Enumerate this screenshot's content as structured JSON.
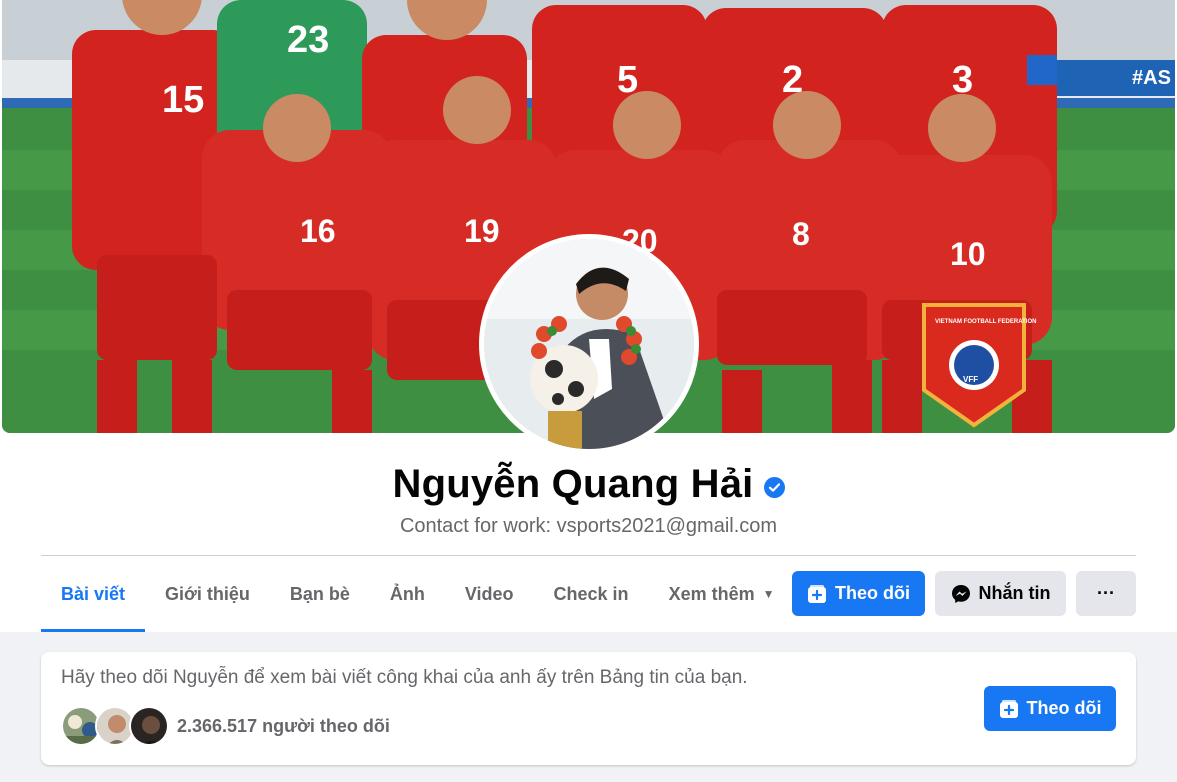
{
  "profile": {
    "name": "Nguyễn Quang Hải",
    "bio": "Contact for work: vsports2021@gmail.com",
    "verified": true
  },
  "cover": {
    "jersey_numbers": [
      "15",
      "23",
      "5",
      "2",
      "3",
      "16",
      "19",
      "20",
      "8",
      "10"
    ],
    "pennant_text": "VIETNAM FOOTBALL FEDERATION",
    "pennant_badge": "VFF",
    "banner_text": "#AS"
  },
  "tabs": [
    {
      "label": "Bài viết",
      "active": true
    },
    {
      "label": "Giới thiệu"
    },
    {
      "label": "Bạn bè"
    },
    {
      "label": "Ảnh"
    },
    {
      "label": "Video"
    },
    {
      "label": "Check in"
    },
    {
      "label": "Xem thêm"
    }
  ],
  "actions": {
    "follow_label": "Theo dõi",
    "message_label": "Nhắn tin",
    "more_label": "···"
  },
  "follow_card": {
    "text": "Hãy theo dõi Nguyễn để xem bài viết công khai của anh ấy trên Bảng tin của bạn.",
    "followers_text": "2.366.517 người theo dõi",
    "follow_label": "Theo dõi"
  },
  "colors": {
    "accent": "#1877f2",
    "jersey_red": "#d2231f",
    "pitch_green": "#3f8d40"
  }
}
